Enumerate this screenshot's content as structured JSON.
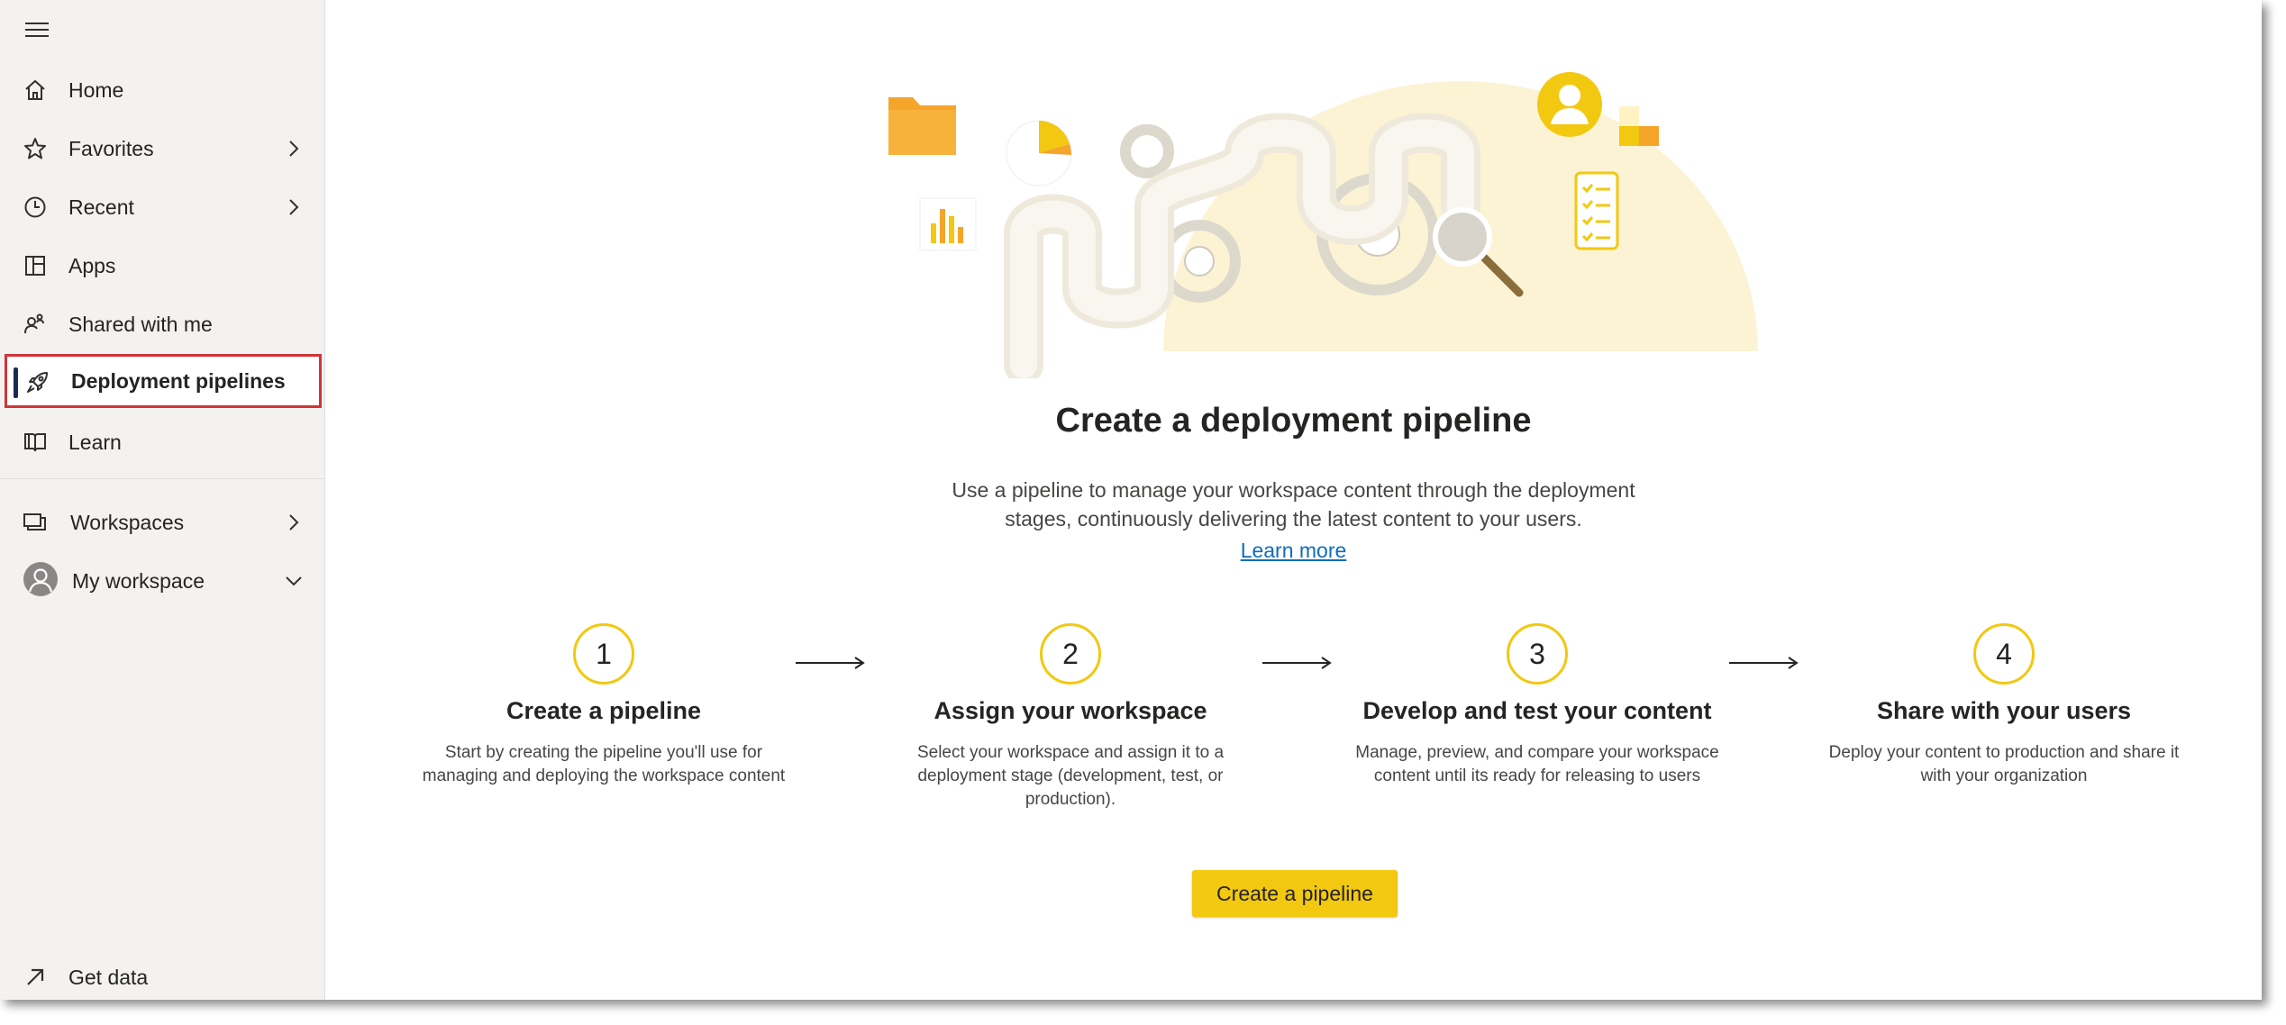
{
  "sidebar": {
    "items": [
      {
        "label": "Home",
        "icon": "home-icon"
      },
      {
        "label": "Favorites",
        "icon": "star-icon"
      },
      {
        "label": "Recent",
        "icon": "clock-icon"
      },
      {
        "label": "Apps",
        "icon": "apps-icon"
      },
      {
        "label": "Shared with me",
        "icon": "shared-icon"
      },
      {
        "label": "Deployment pipelines",
        "icon": "rocket-icon"
      },
      {
        "label": "Learn",
        "icon": "book-icon"
      },
      {
        "label": "Workspaces",
        "icon": "workspaces-icon"
      },
      {
        "label": "My workspace",
        "icon": "avatar-icon"
      }
    ],
    "footer": {
      "label": "Get data",
      "icon": "arrow-up-right-icon"
    }
  },
  "main": {
    "title": "Create a deployment pipeline",
    "description_lines": [
      "Use a pipeline to manage your workspace content through the deployment",
      "stages, continuously delivering the latest content to your users."
    ],
    "learn_more": "Learn more",
    "steps": [
      {
        "number": "1",
        "title": "Create a pipeline",
        "description": "Start by creating the pipeline you'll use for managing and deploying the workspace content"
      },
      {
        "number": "2",
        "title": "Assign your workspace",
        "description": "Select your workspace and assign it to a deployment stage (development, test, or production)."
      },
      {
        "number": "3",
        "title": "Develop and test your content",
        "description": "Manage, preview, and compare your workspace content until its ready for releasing to users"
      },
      {
        "number": "4",
        "title": "Share with your users",
        "description": "Deploy your content to production and share it with your organization"
      }
    ],
    "cta_label": "Create a pipeline"
  },
  "colors": {
    "accent_yellow": "#f2c811",
    "selected_border": "#d13438",
    "link": "#0f6cbd",
    "nav_bg": "#f3f2f1"
  }
}
